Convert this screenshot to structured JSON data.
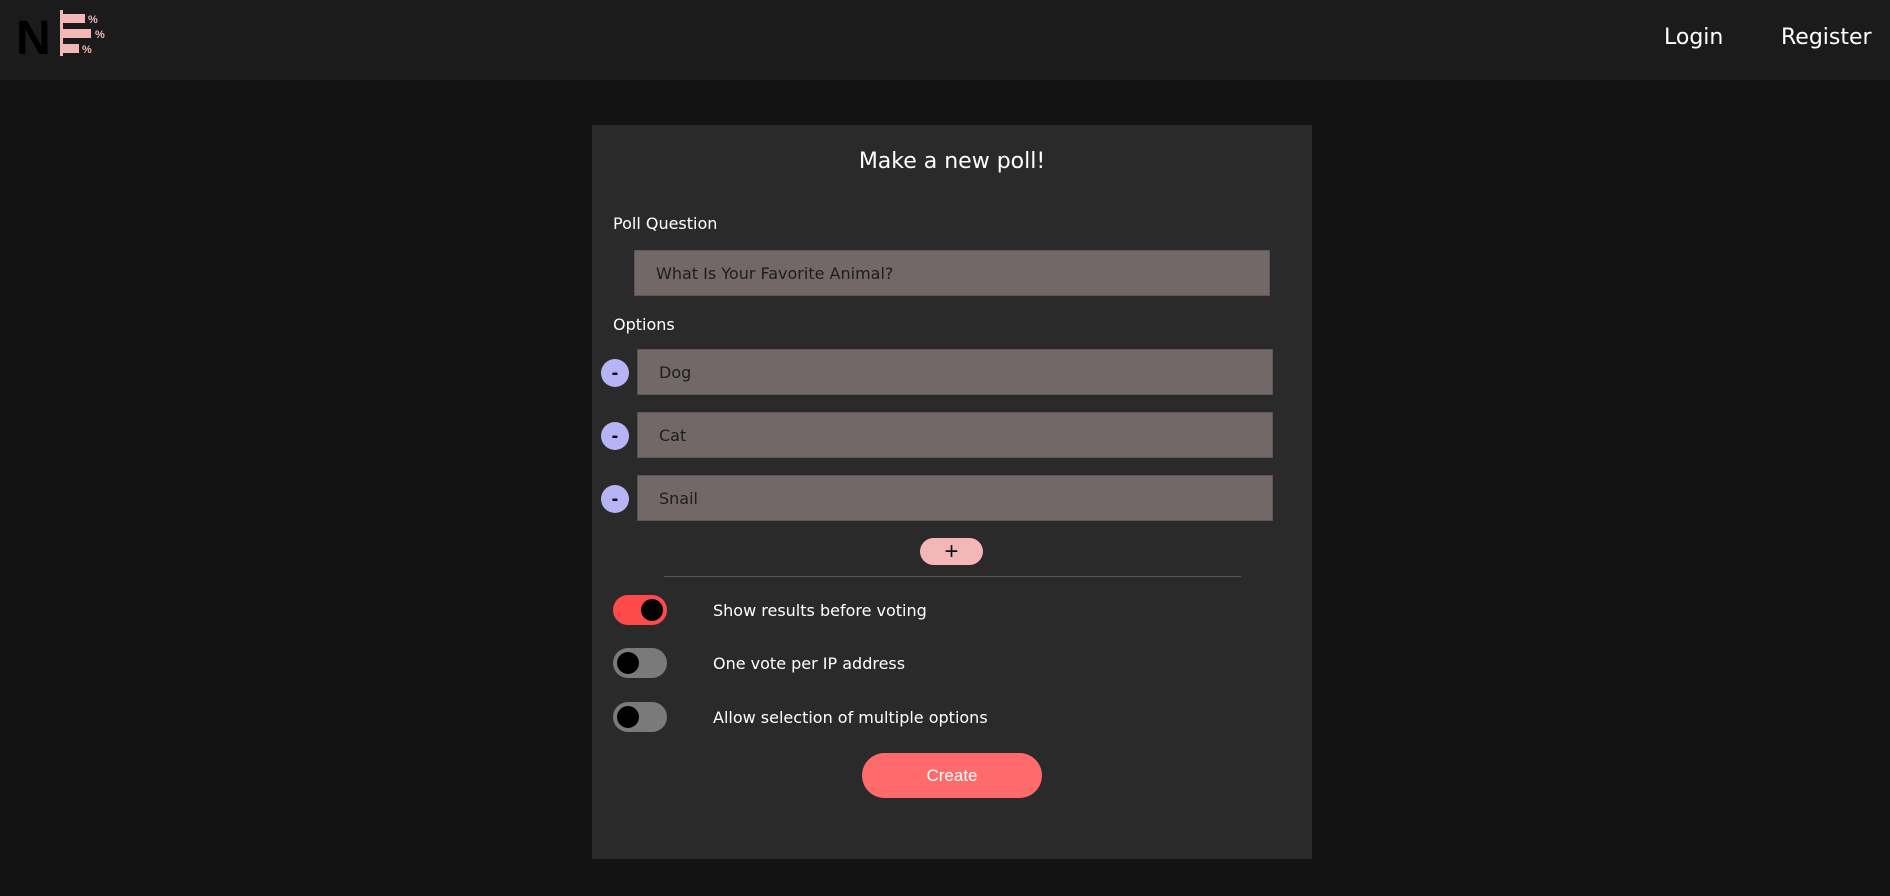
{
  "nav": {
    "logo_text": "N",
    "login": "Login",
    "register": "Register"
  },
  "form": {
    "title": "Make a new poll!",
    "question_label": "Poll Question",
    "question_value": "What Is Your Favorite Animal?",
    "options_label": "Options",
    "options": [
      {
        "value": "Dog",
        "remove": "-"
      },
      {
        "value": "Cat",
        "remove": "-"
      },
      {
        "value": "Snail",
        "remove": "-"
      }
    ],
    "add_label": "+",
    "settings": [
      {
        "label": "Show results before voting",
        "on": true
      },
      {
        "label": "One vote per IP address",
        "on": false
      },
      {
        "label": "Allow selection of multiple options",
        "on": false
      }
    ],
    "create_label": "Create"
  },
  "colors": {
    "accent": "#ff6b6b",
    "toggle_on": "#ff4a4a",
    "remove_button": "#b7b3f4",
    "add_button": "#f4b7b7",
    "field": "#726868"
  }
}
